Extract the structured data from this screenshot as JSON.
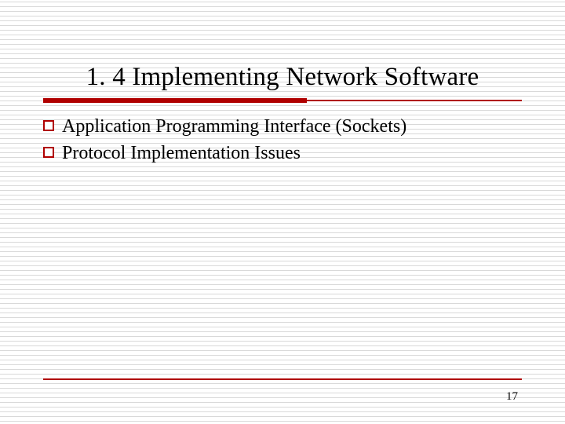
{
  "title": "1. 4 Implementing Network Software",
  "bullets": [
    {
      "text": "Application Programming Interface (Sockets)"
    },
    {
      "text": "Protocol Implementation Issues"
    }
  ],
  "page_number": "17",
  "colors": {
    "accent": "#b00000"
  }
}
